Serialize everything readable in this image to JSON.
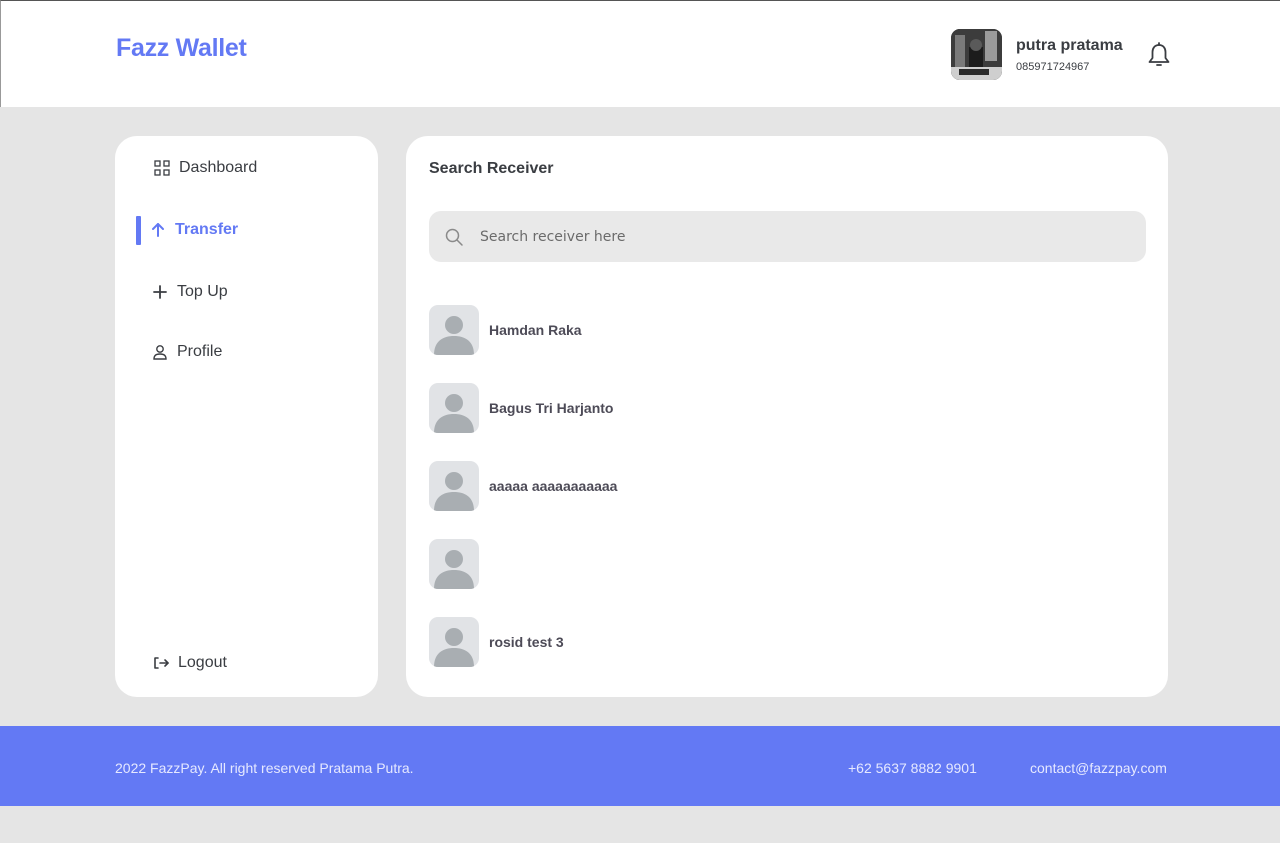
{
  "header": {
    "brand": "Fazz Wallet",
    "user_name": "putra pratama",
    "user_phone": "085971724967",
    "icons": {
      "notification": "bell-icon"
    }
  },
  "sidebar": {
    "items": [
      {
        "label": "Dashboard",
        "icon": "grid-icon",
        "active": false
      },
      {
        "label": "Transfer",
        "icon": "arrow-up-icon",
        "active": true
      },
      {
        "label": "Top Up",
        "icon": "plus-icon",
        "active": false
      },
      {
        "label": "Profile",
        "icon": "user-icon",
        "active": false
      }
    ],
    "logout_label": "Logout"
  },
  "main": {
    "title": "Search Receiver",
    "search": {
      "placeholder": "Search receiver here",
      "value": ""
    },
    "receivers": [
      {
        "name": "Hamdan Raka"
      },
      {
        "name": "Bagus Tri Harjanto"
      },
      {
        "name": "aaaaa aaaaaaaaaaa"
      },
      {
        "name": ""
      },
      {
        "name": "rosid test 3"
      }
    ]
  },
  "footer": {
    "copyright": "2022 FazzPay. All right reserved Pratama Putra.",
    "phone": "+62 5637 8882 9901",
    "email": "contact@fazzpay.com"
  },
  "colors": {
    "accent": "#6379f4",
    "background": "#e5e5e5",
    "card": "#ffffff",
    "text": "#3a3d42"
  }
}
